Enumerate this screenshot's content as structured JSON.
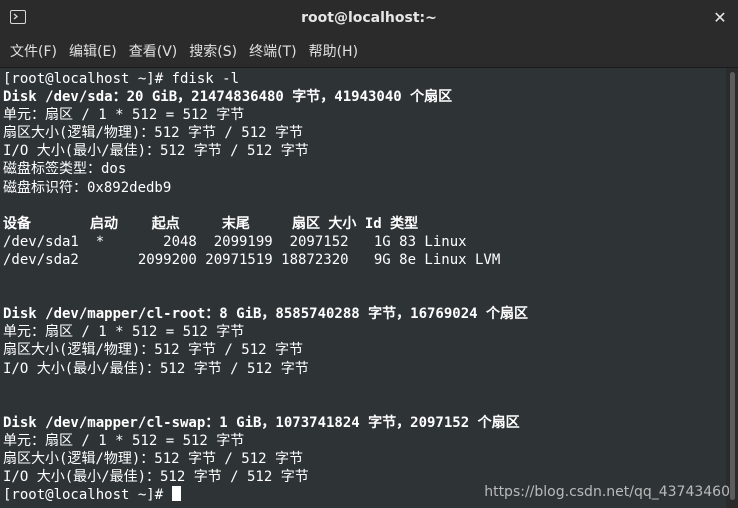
{
  "window": {
    "title": "root@localhost:~",
    "close_label": "✕"
  },
  "menu": [
    {
      "label": "文件(F)"
    },
    {
      "label": "编辑(E)"
    },
    {
      "label": "查看(V)"
    },
    {
      "label": "搜索(S)"
    },
    {
      "label": "终端(T)"
    },
    {
      "label": "帮助(H)"
    }
  ],
  "terminal": {
    "lines": [
      {
        "text": "[root@localhost ~]# fdisk -l",
        "bold": false
      },
      {
        "text": "Disk /dev/sda：20 GiB，21474836480 字节，41943040 个扇区",
        "bold": true
      },
      {
        "text": "单元：扇区 / 1 * 512 = 512 字节",
        "bold": false
      },
      {
        "text": "扇区大小(逻辑/物理)：512 字节 / 512 字节",
        "bold": false
      },
      {
        "text": "I/O 大小(最小/最佳)：512 字节 / 512 字节",
        "bold": false
      },
      {
        "text": "磁盘标签类型：dos",
        "bold": false
      },
      {
        "text": "磁盘标识符：0x892dedb9",
        "bold": false
      },
      {
        "text": "",
        "bold": false
      },
      {
        "text": "设备       启动    起点     末尾     扇区 大小 Id 类型",
        "bold": true
      },
      {
        "text": "/dev/sda1  *       2048  2099199  2097152   1G 83 Linux",
        "bold": false
      },
      {
        "text": "/dev/sda2       2099200 20971519 18872320   9G 8e Linux LVM",
        "bold": false
      },
      {
        "text": "",
        "bold": false
      },
      {
        "text": "",
        "bold": false
      },
      {
        "text": "Disk /dev/mapper/cl-root：8 GiB，8585740288 字节，16769024 个扇区",
        "bold": true
      },
      {
        "text": "单元：扇区 / 1 * 512 = 512 字节",
        "bold": false
      },
      {
        "text": "扇区大小(逻辑/物理)：512 字节 / 512 字节",
        "bold": false
      },
      {
        "text": "I/O 大小(最小/最佳)：512 字节 / 512 字节",
        "bold": false
      },
      {
        "text": "",
        "bold": false
      },
      {
        "text": "",
        "bold": false
      },
      {
        "text": "Disk /dev/mapper/cl-swap：1 GiB，1073741824 字节，2097152 个扇区",
        "bold": true
      },
      {
        "text": "单元：扇区 / 1 * 512 = 512 字节",
        "bold": false
      },
      {
        "text": "扇区大小(逻辑/物理)：512 字节 / 512 字节",
        "bold": false
      },
      {
        "text": "I/O 大小(最小/最佳)：512 字节 / 512 字节",
        "bold": false
      }
    ],
    "prompt": "[root@localhost ~]# "
  },
  "watermark": "https://blog.csdn.net/qq_43743460",
  "colors": {
    "background": "#2e3436",
    "chrome": "#2b2b2b",
    "text": "#ffffff"
  },
  "icons": {
    "app": "terminal-icon",
    "close": "close-icon"
  }
}
